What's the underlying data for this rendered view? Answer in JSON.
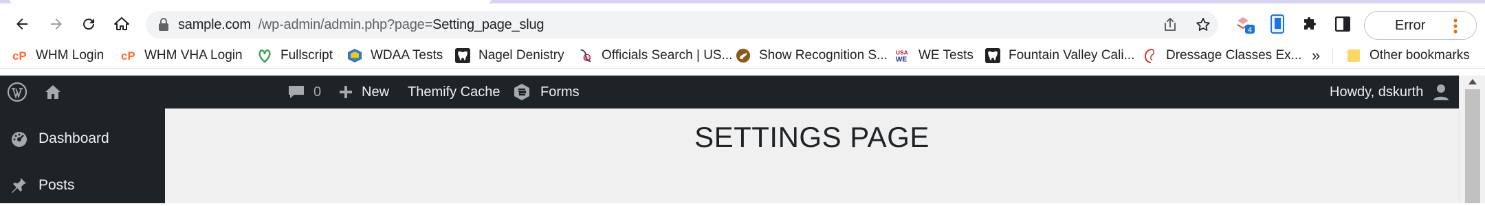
{
  "browser": {
    "url_host": "sample.com",
    "url_path": "/wp-admin/admin.php?page=",
    "url_param": "Setting_page_slug",
    "extension_badge": "4",
    "error_label": "Error"
  },
  "bookmarks": {
    "items": [
      {
        "label": "WHM Login",
        "icon": "cpanel-icon"
      },
      {
        "label": "WHM VHA Login",
        "icon": "cpanel-icon"
      },
      {
        "label": "Fullscript",
        "icon": "fullscript-icon"
      },
      {
        "label": "WDAA Tests",
        "icon": "wdaa-icon"
      },
      {
        "label": "Nagel Denistry",
        "icon": "tooth-icon"
      },
      {
        "label": "Officials Search | US...",
        "icon": "usef-icon"
      },
      {
        "label": "Show Recognition S...",
        "icon": "horse-icon"
      },
      {
        "label": "WE Tests",
        "icon": "usa-we-icon"
      },
      {
        "label": "Fountain Valley Cali...",
        "icon": "tooth-icon"
      },
      {
        "label": "Dressage Classes Ex...",
        "icon": "dressage-icon"
      }
    ],
    "more": "»",
    "other": "Other bookmarks"
  },
  "wp_admin_bar": {
    "comments_count": "0",
    "new_label": "New",
    "themify_label": "Themify Cache",
    "forms_label": "Forms",
    "greeting": "Howdy, dskurth"
  },
  "sidebar": {
    "items": [
      {
        "label": "Dashboard",
        "icon": "dashboard-icon"
      },
      {
        "label": "Posts",
        "icon": "pin-icon"
      }
    ]
  },
  "main": {
    "title": "SETTINGS PAGE"
  },
  "colors": {
    "admin_bar": "#1d2327",
    "content_bg": "#f0f0f1",
    "text": "#1d2327"
  }
}
